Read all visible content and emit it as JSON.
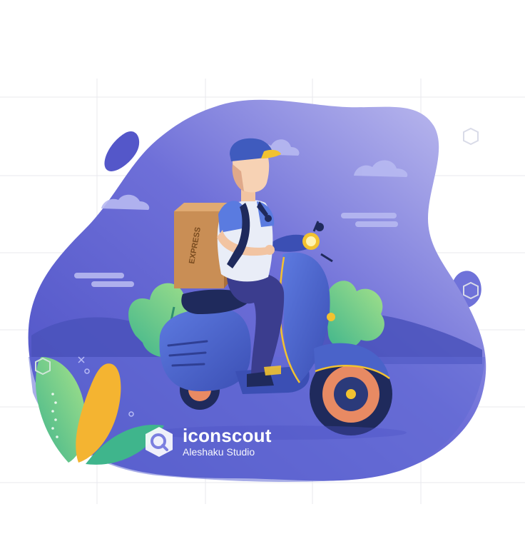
{
  "image": {
    "subject": "delivery-courier-on-scooter",
    "colors": {
      "blob_start": "#5054c8",
      "blob_end": "#b9b8ee",
      "scooter": "#4a63c9",
      "tire": "#1f2a5c",
      "rim": "#e88a63",
      "cap": "#3f5bbe",
      "cap_brim": "#f2c230",
      "box": "#c98e55",
      "shirt_white": "#e9edf7",
      "sleeve": "#5a7be0",
      "pants": "#3b3d8e",
      "leaf_green": "#7ad18a",
      "leaf_yellow": "#f4b431"
    }
  },
  "watermark": {
    "icon": "iconscout-logo-icon",
    "brand": "iconscout",
    "author": "Aleshaku Studio"
  },
  "box_label": "EXPRESS"
}
